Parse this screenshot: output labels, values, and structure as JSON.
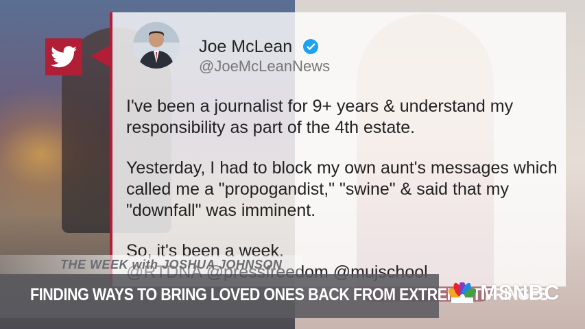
{
  "tweet": {
    "display_name": "Joe McLean",
    "handle": "@JoeMcLeanNews",
    "paragraphs": [
      "I've been a journalist for 9+ years & understand my responsibility as part of the 4th estate.",
      "Yesterday, I had to block my own aunt's messages which called me a \"propogandist,\" \"swine\" & said that my \"downfall\" was imminent.",
      "So, it's been a week."
    ],
    "mentions": "@RTDNA @pressfreedom @mujschool"
  },
  "show": {
    "title": "THE WEEK with JOSHUA JOHNSON"
  },
  "chyron": {
    "headline": "FINDING WAYS TO BRING LOVED ONES BACK FROM EXTREMIST FRINGES"
  },
  "network": {
    "label": "MSNBC"
  },
  "icons": {
    "social": "twitter-bird-icon",
    "verified": "verified-badge-icon",
    "network": "peacock-logo-icon"
  },
  "colors": {
    "accent": "#b01f36",
    "verified": "#1da1f2"
  }
}
